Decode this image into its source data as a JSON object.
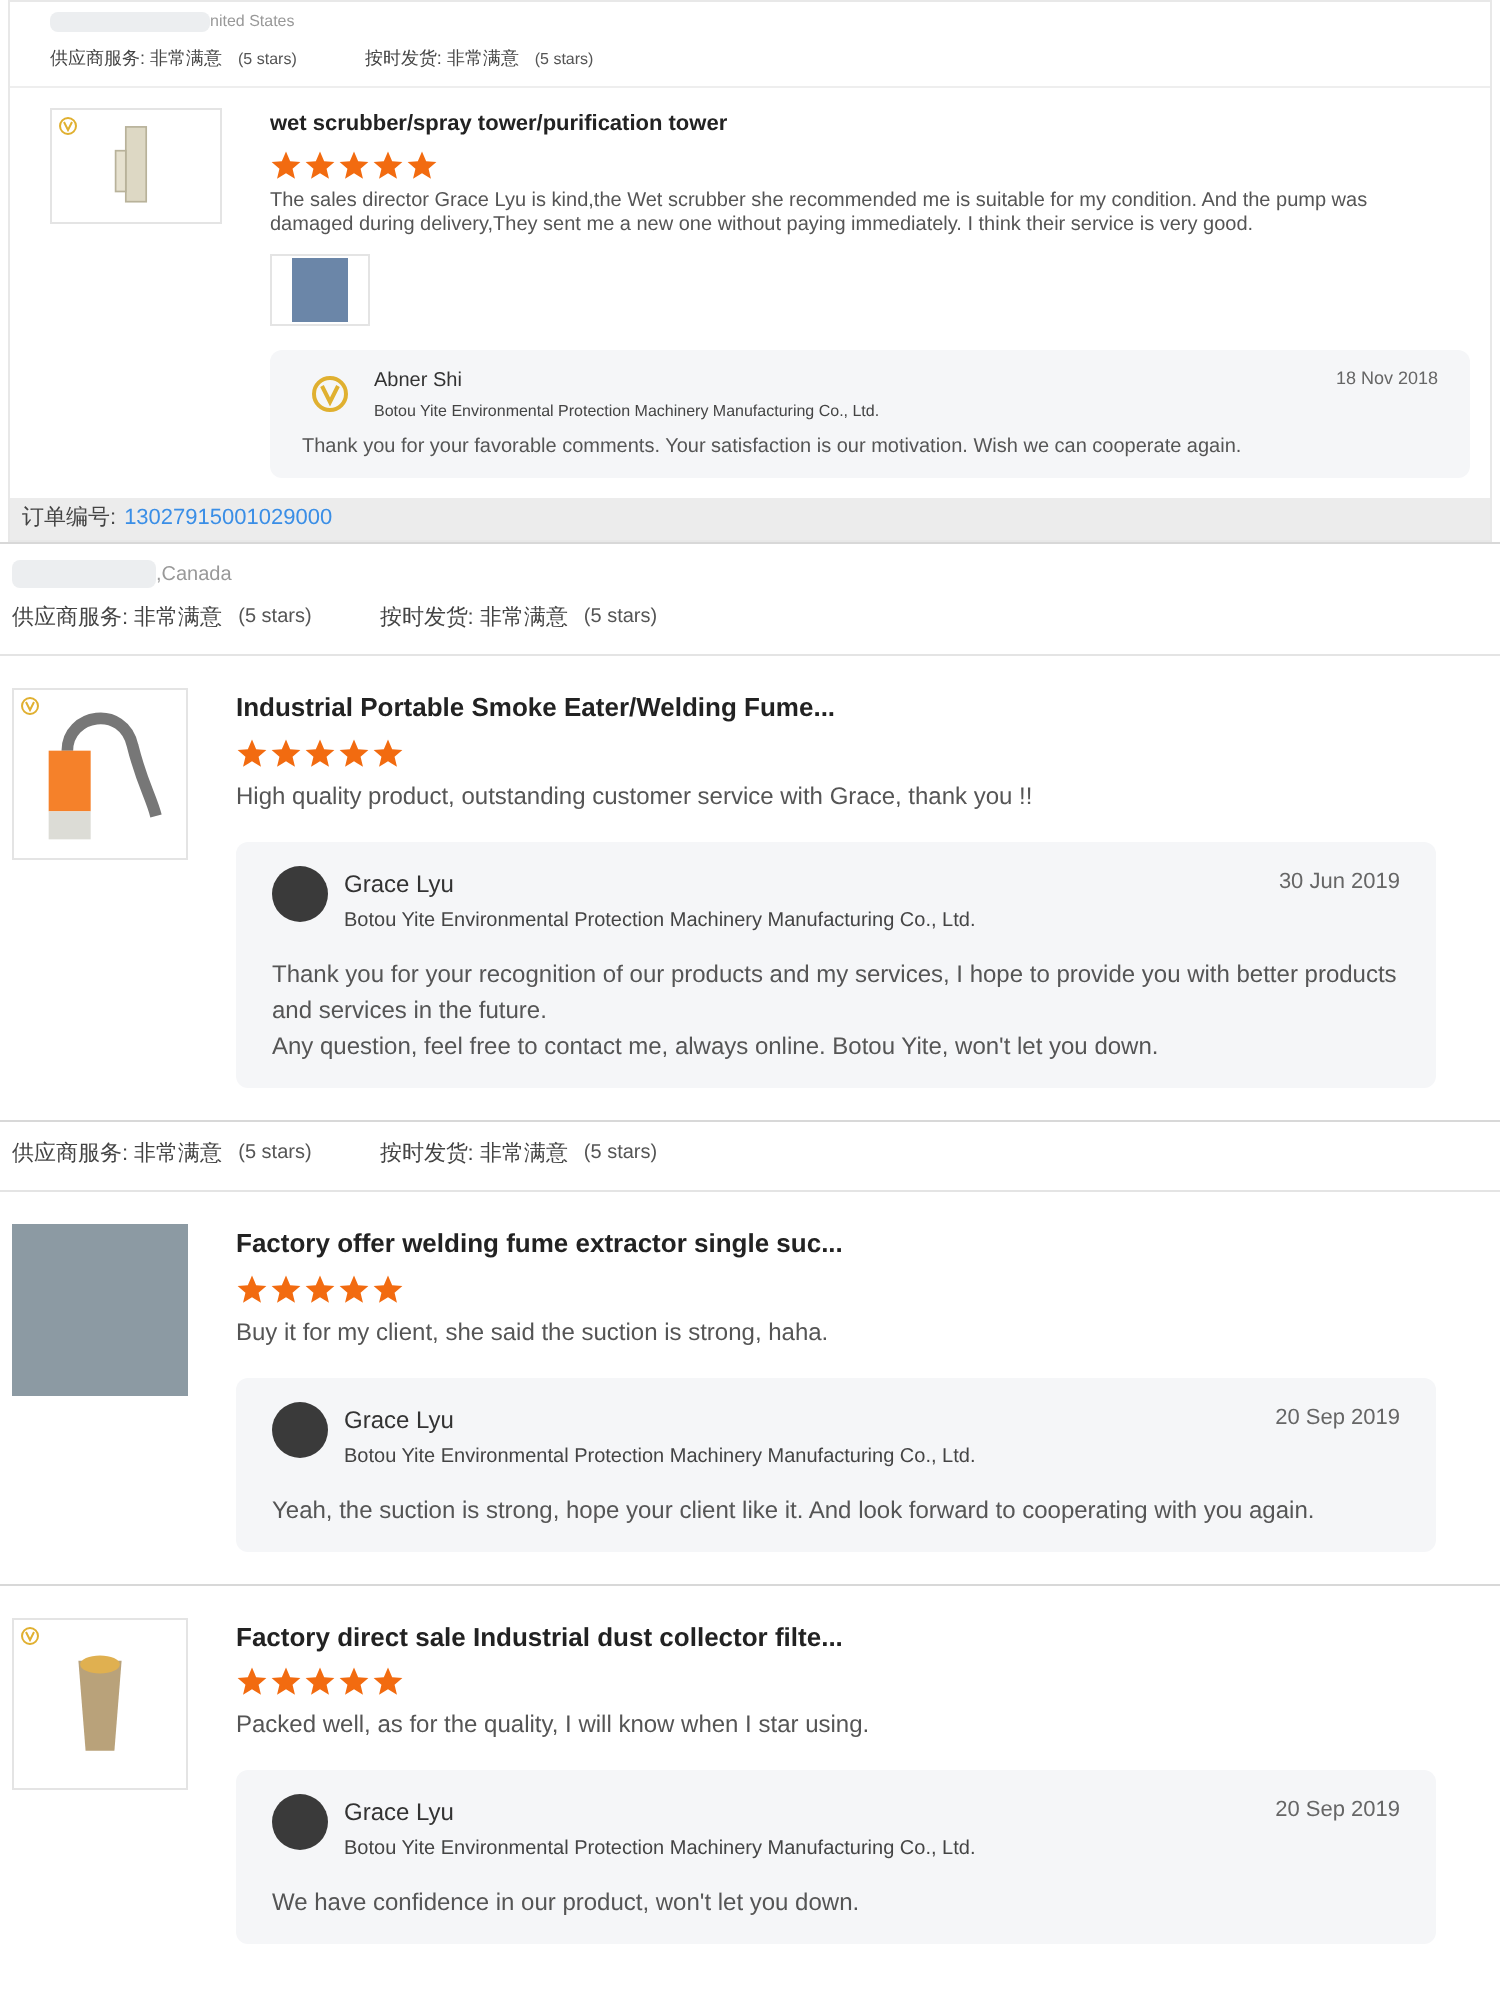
{
  "sections": [
    {
      "location": "nited States",
      "ratings": [
        {
          "label": "供应商服务: 非常满意",
          "note": "(5 stars)"
        },
        {
          "label": "按时发货: 非常满意",
          "note": "(5 stars)"
        }
      ],
      "review": {
        "product": "wet scrubber/spray tower/purification tower",
        "stars": 5,
        "text": "The sales director Grace Lyu is kind,the Wet scrubber she recommended me is suitable for my condition. And the pump was damaged during delivery,They sent me a new one without paying immediately. I think their service is very good.",
        "reply": {
          "name": "Abner Shi",
          "company": "Botou Yite Environmental Protection Machinery Manufacturing Co., Ltd.",
          "date": "18 Nov 2018",
          "text": "Thank you for your favorable comments. Your satisfaction is our motivation. Wish we can cooperate again."
        }
      },
      "order": {
        "label": "订单编号:",
        "value": "13027915001029000"
      }
    },
    {
      "location": ",Canada",
      "ratings": [
        {
          "label": "供应商服务: 非常满意",
          "note": "(5 stars)"
        },
        {
          "label": "按时发货: 非常满意",
          "note": "(5 stars)"
        }
      ],
      "review": {
        "product": "Industrial Portable Smoke Eater/Welding Fume...",
        "stars": 5,
        "text": "High quality product, outstanding customer service with Grace, thank you !!",
        "reply": {
          "name": "Grace Lyu",
          "company": "Botou Yite Environmental Protection Machinery Manufacturing Co., Ltd.",
          "date": "30 Jun 2019",
          "text": "Thank you for your recognition of our products and my services, I hope to provide you with better products and services in the future.\nAny question, feel free to contact me, always online. Botou Yite, won't let you down."
        }
      }
    },
    {
      "ratings": [
        {
          "label": "供应商服务: 非常满意",
          "note": "(5 stars)"
        },
        {
          "label": "按时发货: 非常满意",
          "note": "(5 stars)"
        }
      ],
      "review": {
        "product": "Factory offer welding fume extractor single suc...",
        "stars": 5,
        "text": "Buy it for my client, she said the suction is strong, haha.",
        "reply": {
          "name": "Grace Lyu",
          "company": "Botou Yite Environmental Protection Machinery Manufacturing Co., Ltd.",
          "date": "20 Sep 2019",
          "text": "Yeah, the suction is strong,  hope your client like it. And look forward to cooperating with you again."
        }
      }
    },
    {
      "review": {
        "product": "Factory direct sale Industrial dust collector filte...",
        "stars": 5,
        "text": "Packed well, as for the quality, I will know when I star using.",
        "reply": {
          "name": "Grace Lyu",
          "company": "Botou Yite Environmental Protection Machinery Manufacturing Co., Ltd.",
          "date": "20 Sep 2019",
          "text": "We have confidence in our product, won't let you down."
        }
      }
    }
  ]
}
